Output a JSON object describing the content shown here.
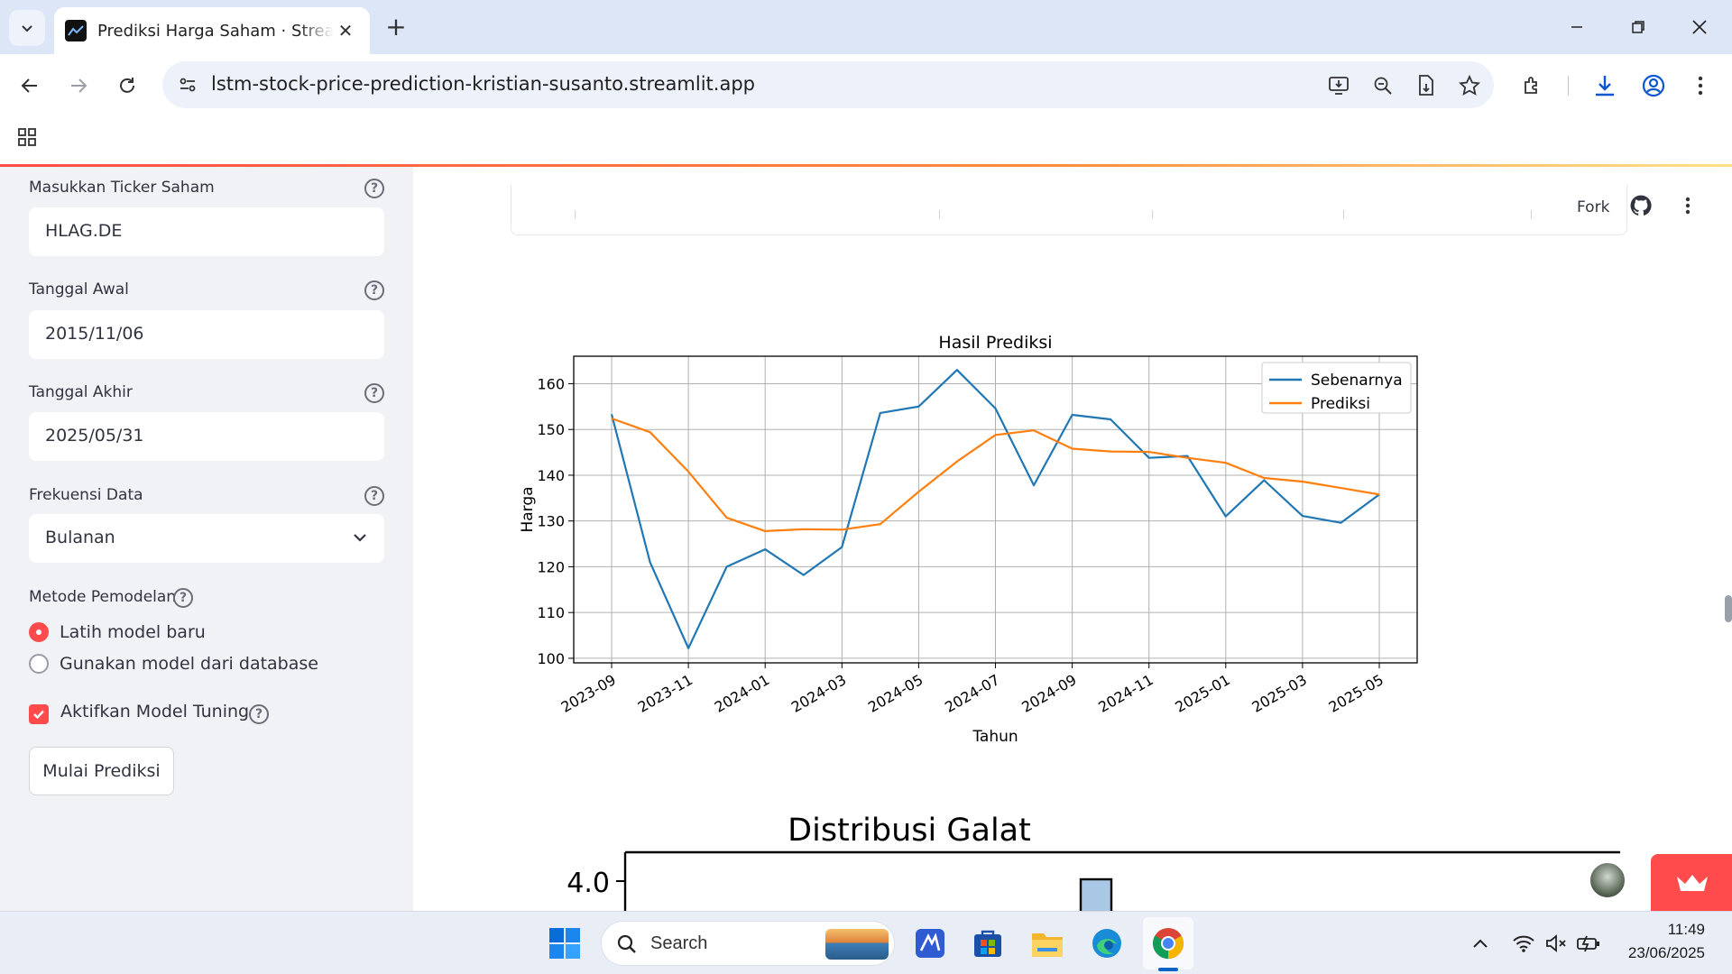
{
  "browser": {
    "tab_title": "Prediksi Harga Saham · Streamlit",
    "url": "lstm-stock-price-prediction-kristian-susanto.streamlit.app",
    "close_glyph": "✕",
    "new_tab_glyph": "+"
  },
  "sidebar": {
    "ticker": {
      "label": "Masukkan Ticker Saham",
      "value": "HLAG.DE"
    },
    "start_date": {
      "label": "Tanggal Awal",
      "value": "2015/11/06"
    },
    "end_date": {
      "label": "Tanggal Akhir",
      "value": "2025/05/31"
    },
    "frequency": {
      "label": "Frekuensi Data",
      "value": "Bulanan"
    },
    "method": {
      "label": "Metode Pemodelan",
      "options": [
        "Latih model baru",
        "Gunakan model dari database"
      ],
      "selected_index": 0
    },
    "tuning": {
      "label": "Aktifkan Model Tuning",
      "checked": true
    },
    "start_button": "Mulai Prediksi",
    "help_glyph": "?"
  },
  "main": {
    "fork_label": "Fork"
  },
  "chart_data": [
    {
      "type": "line",
      "title": "Hasil Prediksi",
      "xlabel": "Tahun",
      "ylabel": "Harga",
      "x": [
        "2023-09",
        "2023-10",
        "2023-11",
        "2023-12",
        "2024-01",
        "2024-02",
        "2024-03",
        "2024-04",
        "2024-05",
        "2024-06",
        "2024-07",
        "2024-08",
        "2024-09",
        "2024-10",
        "2024-11",
        "2024-12",
        "2025-01",
        "2025-02",
        "2025-03",
        "2025-04",
        "2025-05"
      ],
      "x_ticks": [
        "2023-09",
        "2023-11",
        "2024-01",
        "2024-03",
        "2024-05",
        "2024-07",
        "2024-09",
        "2024-11",
        "2025-01",
        "2025-03",
        "2025-05"
      ],
      "y_ticks": [
        100,
        110,
        120,
        130,
        140,
        150,
        160
      ],
      "ylim": [
        99,
        166
      ],
      "grid": true,
      "legend_position": "top-right",
      "series": [
        {
          "name": "Sebenarnya",
          "color": "#1f77b4",
          "values": [
            153.3,
            121.0,
            102.2,
            120.0,
            123.8,
            118.2,
            124.3,
            153.6,
            155.0,
            163.0,
            154.6,
            137.8,
            153.2,
            152.2,
            143.8,
            144.2,
            131.0,
            138.9,
            131.1,
            129.6,
            135.8
          ]
        },
        {
          "name": "Prediksi",
          "color": "#ff7f0e",
          "values": [
            152.4,
            149.4,
            140.8,
            130.7,
            127.8,
            128.2,
            128.1,
            129.3,
            136.4,
            143.0,
            148.8,
            149.8,
            145.8,
            145.2,
            145.1,
            143.8,
            142.7,
            139.4,
            138.6,
            137.2,
            135.8
          ]
        }
      ]
    },
    {
      "type": "bar",
      "title": "Distribusi Galat",
      "y_ticks": [
        4.0
      ],
      "partial": true
    }
  ],
  "taskbar": {
    "search_label": "Search",
    "time": "11:49",
    "date": "23/06/2025"
  },
  "colors": {
    "accent": "#ff4b4b",
    "sidebar_bg": "#f0f2f6",
    "chrome_tab_strip": "#dde6f6"
  }
}
